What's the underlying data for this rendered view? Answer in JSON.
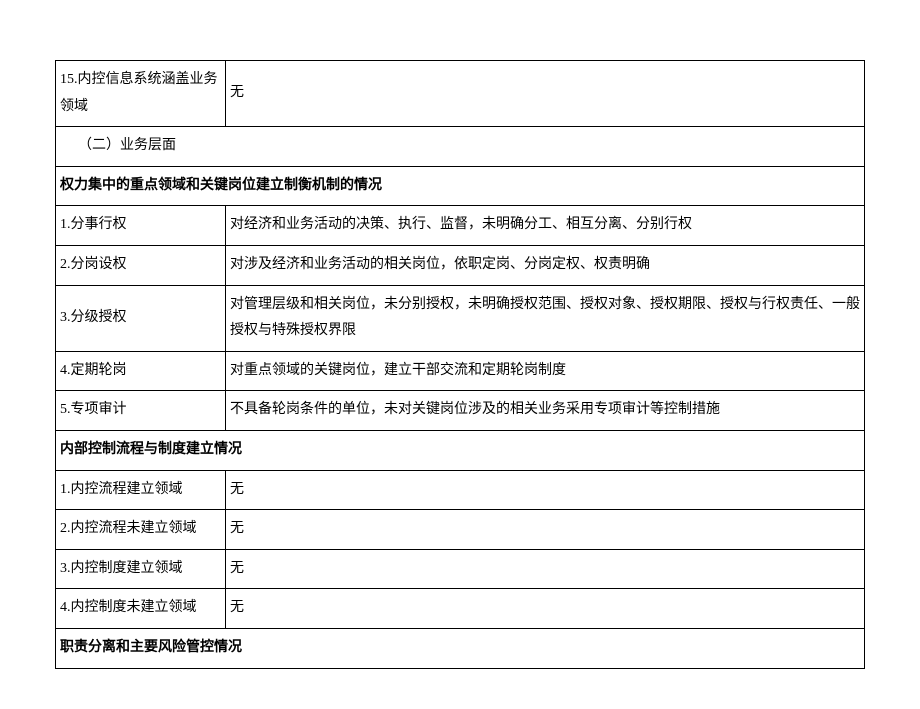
{
  "rows": [
    {
      "label": "15.内控信息系统涵盖业务领域",
      "value": "无"
    }
  ],
  "section1_title": "（二）业务层面",
  "section1_header": "权力集中的重点领域和关键岗位建立制衡机制的情况",
  "section1_rows": [
    {
      "label": "1.分事行权",
      "value": "对经济和业务活动的决策、执行、监督，未明确分工、相互分离、分别行权"
    },
    {
      "label": "2.分岗设权",
      "value": "对涉及经济和业务活动的相关岗位，依职定岗、分岗定权、权责明确"
    },
    {
      "label": "3.分级授权",
      "value": "对管理层级和相关岗位，未分别授权，未明确授权范围、授权对象、授权期限、授权与行权责任、一般授权与特殊授权界限"
    },
    {
      "label": "4.定期轮岗",
      "value": "对重点领域的关键岗位，建立干部交流和定期轮岗制度"
    },
    {
      "label": "5.专项审计",
      "value": "不具备轮岗条件的单位，未对关键岗位涉及的相关业务采用专项审计等控制措施"
    }
  ],
  "section2_header": "内部控制流程与制度建立情况",
  "section2_rows": [
    {
      "label": "1.内控流程建立领域",
      "value": "无"
    },
    {
      "label": "2.内控流程未建立领域",
      "value": "无"
    },
    {
      "label": "3.内控制度建立领域",
      "value": "无"
    },
    {
      "label": "4.内控制度未建立领域",
      "value": "无"
    }
  ],
  "section3_header": "职责分离和主要风险管控情况"
}
